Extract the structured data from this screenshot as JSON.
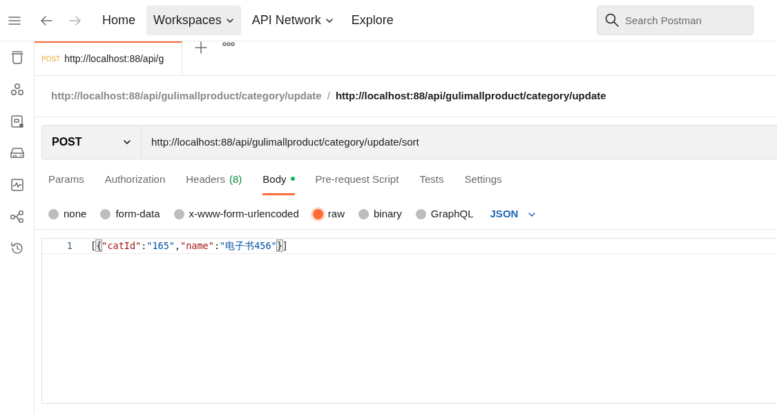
{
  "topbar": {
    "nav": [
      {
        "label": "Home",
        "selected": false,
        "dropdown": false
      },
      {
        "label": "Workspaces",
        "selected": true,
        "dropdown": true
      },
      {
        "label": "API Network",
        "selected": false,
        "dropdown": true
      },
      {
        "label": "Explore",
        "selected": false,
        "dropdown": false
      }
    ],
    "search": {
      "placeholder": "Search Postman"
    }
  },
  "sidebar": {
    "items": [
      {
        "kind": "trash"
      },
      {
        "kind": "apis"
      },
      {
        "kind": "environments"
      },
      {
        "kind": "mock"
      },
      {
        "kind": "monitors"
      },
      {
        "kind": "flows"
      },
      {
        "kind": "history"
      }
    ]
  },
  "request_tabs": [
    {
      "method": "POST",
      "title": "http://localhost:88/api/g",
      "selected": true
    }
  ],
  "breadcrumb": {
    "parent": "http://localhost:88/api/gulimallproduct/category/update",
    "separator": "/",
    "current": "http://localhost:88/api/gulimallproduct/category/update"
  },
  "request": {
    "method": "POST",
    "url": "http://localhost:88/api/gulimallproduct/category/update/sort"
  },
  "section_tabs": [
    {
      "label": "Params",
      "selected": false
    },
    {
      "label": "Authorization",
      "selected": false
    },
    {
      "label": "Headers",
      "count": "(8)",
      "selected": false
    },
    {
      "label": "Body",
      "selected": true,
      "indicator": true
    },
    {
      "label": "Pre-request Script",
      "selected": false
    },
    {
      "label": "Tests",
      "selected": false
    },
    {
      "label": "Settings",
      "selected": false
    }
  ],
  "body_types": [
    {
      "label": "none",
      "selected": false
    },
    {
      "label": "form-data",
      "selected": false
    },
    {
      "label": "x-www-form-urlencoded",
      "selected": false
    },
    {
      "label": "raw",
      "selected": true
    },
    {
      "label": "binary",
      "selected": false
    },
    {
      "label": "GraphQL",
      "selected": false
    }
  ],
  "format": "JSON",
  "editor": {
    "lines": [
      {
        "number": "1",
        "tokens": [
          {
            "kind": "punct",
            "text": "["
          },
          {
            "kind": "match",
            "text": "{"
          },
          {
            "kind": "key",
            "text": "\"catId\""
          },
          {
            "kind": "punct",
            "text": ":"
          },
          {
            "kind": "string",
            "text": "\"165\""
          },
          {
            "kind": "punct",
            "text": ","
          },
          {
            "kind": "key",
            "text": "\"name\""
          },
          {
            "kind": "punct",
            "text": ":"
          },
          {
            "kind": "string",
            "text": "\"电子书456\""
          },
          {
            "kind": "match",
            "text": "}"
          },
          {
            "kind": "punct",
            "text": "]"
          }
        ]
      }
    ]
  }
}
